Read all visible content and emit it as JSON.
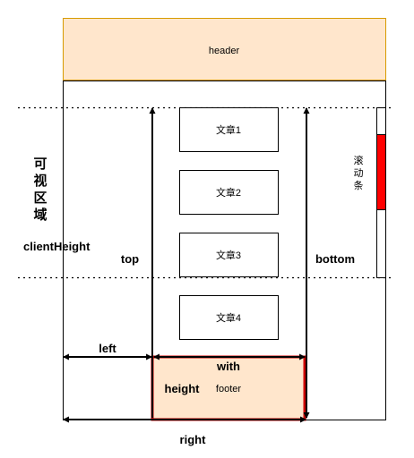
{
  "header": {
    "label": "header",
    "fill": "#ffe6cc",
    "stroke": "#d79b00"
  },
  "articles": [
    {
      "label": "文章1"
    },
    {
      "label": "文章2"
    },
    {
      "label": "文章3"
    },
    {
      "label": "文章4"
    }
  ],
  "scrollbar": {
    "label_chars": [
      "滚",
      "动",
      "条"
    ],
    "thumb_color": "#ff0000"
  },
  "viewport": {
    "label_chars": [
      "可",
      "视",
      "区",
      "域"
    ],
    "height_label": "clientHeight"
  },
  "footer": {
    "label": "footer",
    "fill": "#ffe6cc",
    "stroke": "#cc0000"
  },
  "measures": {
    "top": "top",
    "bottom": "bottom",
    "left": "left",
    "right": "right",
    "width": "with",
    "height": "height"
  }
}
